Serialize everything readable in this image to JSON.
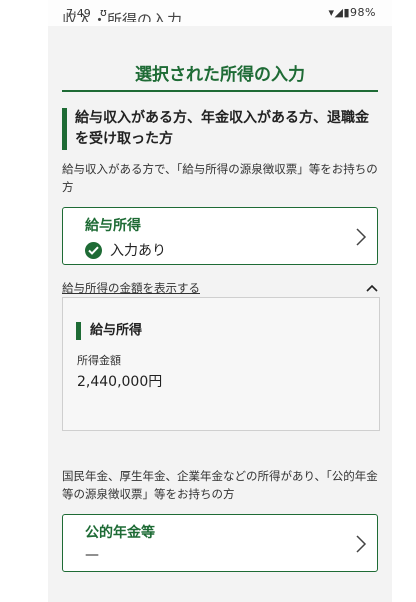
{
  "status_bar": {
    "time": "7:49",
    "notification_glyph": "ʊ",
    "battery": "98%"
  },
  "previous_heading": "収入・所得の入力",
  "page_title": "選択された所得の入力",
  "salary_section": {
    "heading": "給与収入がある方、年金収入がある方、退職金を受け取った方",
    "description": "給与収入がある方で、「給与所得の源泉徴収票」等をお持ちの方",
    "card": {
      "title": "給与所得",
      "status": "入力あり"
    },
    "toggle_label": "給与所得の金額を表示する",
    "detail": {
      "title": "給与所得",
      "amount_label": "所得金額",
      "amount_value": "2,440,000円"
    }
  },
  "pension_section": {
    "description": "国民年金、厚生年金、企業年金などの所得があり、「公的年金等の源泉徴収票」等をお持ちの方",
    "card": {
      "title": "公的年金等",
      "status": "—"
    }
  },
  "colors": {
    "accent": "#1e6b35",
    "background": "#f3f3f3"
  }
}
